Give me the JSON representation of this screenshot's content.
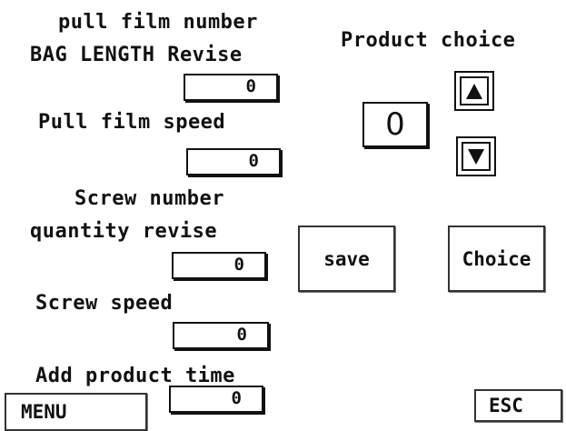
{
  "labels": {
    "pull_film_number": "pull film number",
    "bag_length_revise": "BAG LENGTH Revise",
    "pull_film_speed": "Pull film speed",
    "screw_number": "Screw number",
    "quantity_revise": "quantity revise",
    "screw_speed": "Screw speed",
    "add_product_time": "Add product time",
    "product_choice": "Product choice"
  },
  "fields": {
    "bag_length_revise": "0",
    "pull_film_speed": "0",
    "screw_quantity_revise": "0",
    "screw_speed": "0",
    "add_product_time": "0"
  },
  "product_number": "0",
  "buttons": {
    "save": "save",
    "choice": "Choice",
    "menu": "MENU",
    "esc": "ESC"
  },
  "icons": {
    "up": "up-arrow",
    "down": "down-arrow"
  }
}
